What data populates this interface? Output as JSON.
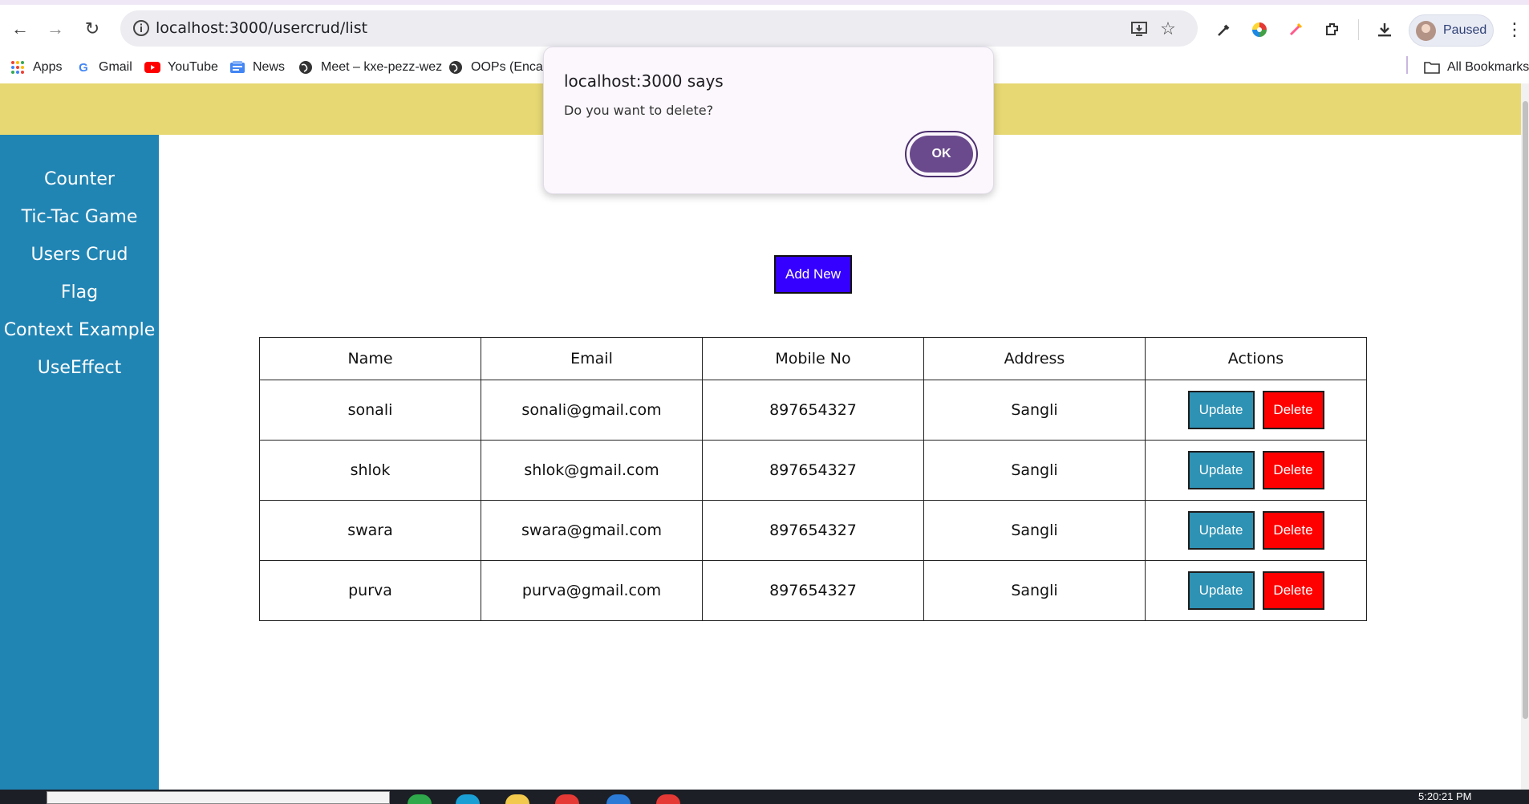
{
  "browser": {
    "url": "localhost:3000/usercrud/list",
    "profile_label": "Paused"
  },
  "bookmarks": [
    {
      "label": "Apps",
      "icon": "apps-grid-icon"
    },
    {
      "label": "Gmail",
      "icon": "google-icon"
    },
    {
      "label": "YouTube",
      "icon": "youtube-icon"
    },
    {
      "label": "News",
      "icon": "news-icon"
    },
    {
      "label": "Meet – kxe-pezz-wez",
      "icon": "globe-icon"
    },
    {
      "label": "OOPs (Encaps",
      "icon": "globe-icon"
    }
  ],
  "all_bookmarks_label": "All Bookmarks",
  "sidebar": {
    "items": [
      {
        "label": "Counter"
      },
      {
        "label": "Tic-Tac Game"
      },
      {
        "label": "Users Crud"
      },
      {
        "label": "Flag"
      },
      {
        "label": "Context Example"
      },
      {
        "label": "UseEffect"
      }
    ]
  },
  "main": {
    "add_button_label": "Add New",
    "table": {
      "columns": [
        "Name",
        "Email",
        "Mobile No",
        "Address",
        "Actions"
      ],
      "rows": [
        {
          "name": "sonali",
          "email": "sonali@gmail.com",
          "mobile": "897654327",
          "address": "Sangli"
        },
        {
          "name": "shlok",
          "email": "shlok@gmail.com",
          "mobile": "897654327",
          "address": "Sangli"
        },
        {
          "name": "swara",
          "email": "swara@gmail.com",
          "mobile": "897654327",
          "address": "Sangli"
        },
        {
          "name": "purva",
          "email": "purva@gmail.com",
          "mobile": "897654327",
          "address": "Sangli"
        }
      ],
      "update_label": "Update",
      "delete_label": "Delete"
    }
  },
  "dialog": {
    "title": "localhost:3000 says",
    "message": "Do you want to delete?",
    "ok_label": "OK"
  },
  "taskbar": {
    "time": "5:20:21 PM"
  },
  "colors": {
    "header_band": "#e7d873",
    "sidebar": "#2185b4",
    "add_button": "#3500ff",
    "update_button": "#2e92b4",
    "delete_button": "#ff0000",
    "ok_button": "#6a4a8c"
  }
}
